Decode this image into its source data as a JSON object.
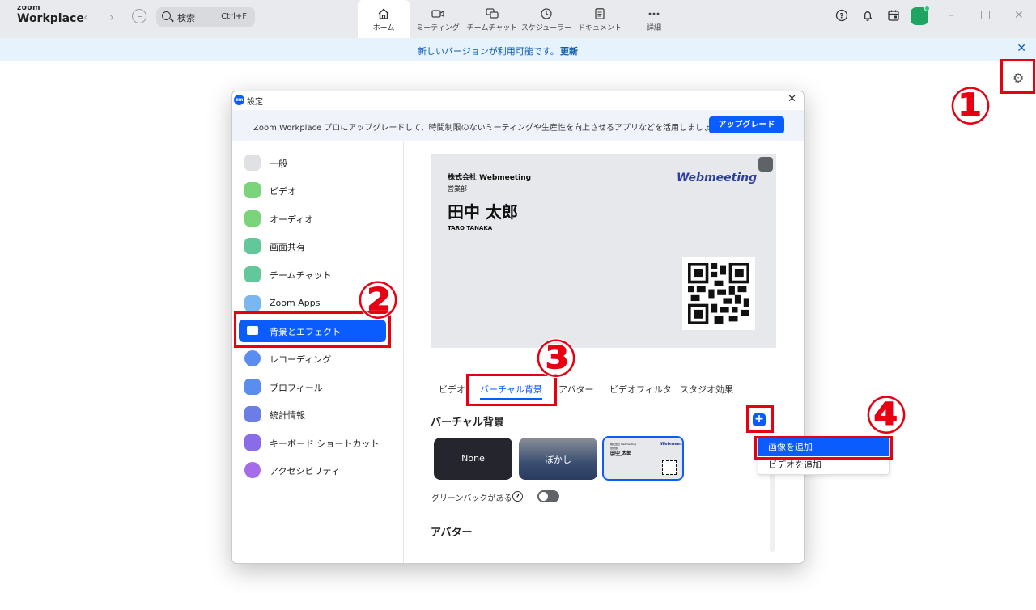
{
  "app": {
    "brand_top": "zoom",
    "brand_name": "Workplace"
  },
  "search": {
    "placeholder": "検索",
    "shortcut": "Ctrl+F"
  },
  "tabs": [
    {
      "label": "ホーム",
      "icon": "home-icon",
      "active": true
    },
    {
      "label": "ミーティング",
      "icon": "video-icon"
    },
    {
      "label": "チームチャット",
      "icon": "chat-icon"
    },
    {
      "label": "スケジューラー",
      "icon": "clock-icon"
    },
    {
      "label": "ドキュメント",
      "icon": "document-icon"
    },
    {
      "label": "詳細",
      "icon": "more-icon"
    }
  ],
  "notice": {
    "text": "新しいバージョンが利用可能です。",
    "link": "更新"
  },
  "annotations": [
    "①",
    "②",
    "③",
    "④"
  ],
  "dialog": {
    "title": "設定",
    "logo": "zm",
    "upgrade_text": "Zoom Workplace プロにアップグレードして、時間制限のないミーティングや生産性を向上させるアプリなどを活用しましょう。",
    "upgrade_button": "アップグレード"
  },
  "sidebar": {
    "items": [
      {
        "label": "一般",
        "icon": "gear-icon",
        "color": "#c9ccd1"
      },
      {
        "label": "ビデオ",
        "icon": "video-icon",
        "color": "#7bd47b"
      },
      {
        "label": "オーディオ",
        "icon": "headphones-icon",
        "color": "#7bd47b"
      },
      {
        "label": "画面共有",
        "icon": "share-screen-icon",
        "color": "#62c79a"
      },
      {
        "label": "チームチャット",
        "icon": "chat-icon",
        "color": "#62c79a"
      },
      {
        "label": "Zoom Apps",
        "icon": "apps-icon",
        "color": "#7ab6f0"
      },
      {
        "label": "背景とエフェクト",
        "icon": "background-icon",
        "color": "#0b5cff",
        "active": true
      },
      {
        "label": "レコーディング",
        "icon": "record-icon",
        "color": "#5b8cf0"
      },
      {
        "label": "プロフィール",
        "icon": "profile-icon",
        "color": "#5b8cf0"
      },
      {
        "label": "統計情報",
        "icon": "stats-icon",
        "color": "#6b7ee8"
      },
      {
        "label": "キーボード ショートカット",
        "icon": "keyboard-icon",
        "color": "#8a6be8"
      },
      {
        "label": "アクセシビリティ",
        "icon": "accessibility-icon",
        "color": "#a56be8"
      }
    ]
  },
  "preview": {
    "company": "株式会社 Webmeeting",
    "department": "営業部",
    "name": "田中 太郎",
    "name_en": "TARO TANAKA",
    "logo": "Webmeeting"
  },
  "content_tabs": [
    {
      "label": "ビデオ"
    },
    {
      "label": "バーチャル背景",
      "active": true
    },
    {
      "label": "アバター"
    },
    {
      "label": "ビデオフィルタ"
    },
    {
      "label": "スタジオ効果"
    }
  ],
  "virtual_bg": {
    "heading": "バーチャル背景",
    "add_button": "+",
    "thumbs": [
      "None",
      "ぼかし"
    ],
    "greenscreen_label": "グリーンバックがある",
    "greenscreen_on": false
  },
  "avatar_heading": "アバター",
  "add_menu": {
    "items": [
      "画像を追加",
      "ビデオを追加"
    ]
  }
}
